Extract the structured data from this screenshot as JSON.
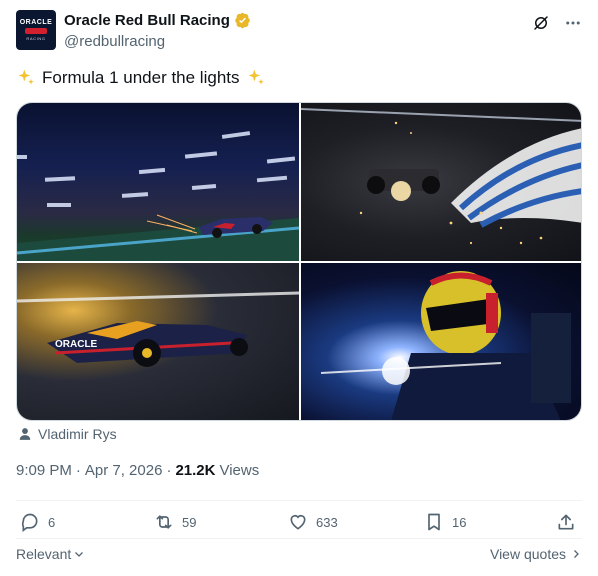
{
  "author": {
    "display_name": "Oracle Red Bull Racing",
    "handle": "@redbullracing",
    "avatar_text": "ORACLE",
    "avatar_subtext": "RACING"
  },
  "tweet": {
    "text": "Formula 1 under the lights"
  },
  "media": {
    "logo_text": "ORACLE"
  },
  "photo_credit": "Vladimir Rys",
  "meta": {
    "time": "9:09 PM",
    "date": "Apr 7, 2026",
    "views_count": "21.2K",
    "views_label": "Views"
  },
  "actions": {
    "replies": "6",
    "reposts": "59",
    "likes": "633",
    "bookmarks": "16"
  },
  "footer": {
    "relevant": "Relevant",
    "view_quotes": "View quotes"
  },
  "colors": {
    "verified": "#e8b829",
    "muted": "#536471"
  }
}
